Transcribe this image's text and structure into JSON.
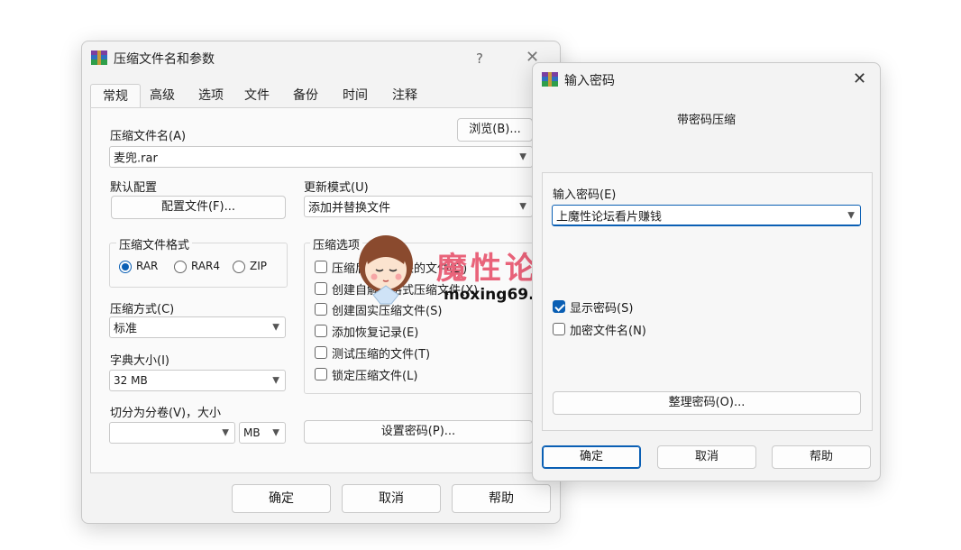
{
  "main_dialog": {
    "title": "压缩文件名和参数",
    "help_glyph": "?",
    "close_glyph": "✕",
    "tabs": [
      "常规",
      "高级",
      "选项",
      "文件",
      "备份",
      "时间",
      "注释"
    ],
    "archive_name_label": "压缩文件名(A)",
    "browse_button": "浏览(B)...",
    "archive_name_value": "麦兜.rar",
    "default_profile_label": "默认配置",
    "profile_button": "配置文件(F)...",
    "update_mode_label": "更新模式(U)",
    "update_mode_value": "添加并替换文件",
    "format_group_label": "压缩文件格式",
    "formats": [
      {
        "label": "RAR",
        "selected": true
      },
      {
        "label": "RAR4",
        "selected": false
      },
      {
        "label": "ZIP",
        "selected": false
      }
    ],
    "options_group_label": "压缩选项",
    "options": [
      {
        "label": "压缩后删除原来的文件(D)",
        "checked": false
      },
      {
        "label": "创建自解压格式压缩文件(X)",
        "checked": false
      },
      {
        "label": "创建固实压缩文件(S)",
        "checked": false
      },
      {
        "label": "添加恢复记录(E)",
        "checked": false
      },
      {
        "label": "测试压缩的文件(T)",
        "checked": false
      },
      {
        "label": "锁定压缩文件(L)",
        "checked": false
      }
    ],
    "method_label": "压缩方式(C)",
    "method_value": "标准",
    "dict_label": "字典大小(I)",
    "dict_value": "32 MB",
    "split_label": "切分为分卷(V)，大小",
    "split_value": "",
    "split_unit": "MB",
    "set_password_button": "设置密码(P)...",
    "ok_button": "确定",
    "cancel_button": "取消",
    "help_button": "帮助"
  },
  "password_dialog": {
    "title": "输入密码",
    "close_glyph": "✕",
    "heading": "带密码压缩",
    "password_label": "输入密码(E)",
    "password_value": "上魔性论坛看片赚钱",
    "show_password_label": "显示密码(S)",
    "show_password_checked": true,
    "encrypt_names_label": "加密文件名(N)",
    "encrypt_names_checked": false,
    "organize_button": "整理密码(O)...",
    "ok_button": "确定",
    "cancel_button": "取消",
    "help_button": "帮助"
  },
  "watermark": {
    "brand": "魔性论坛",
    "url": "moxing69.com"
  },
  "colors": {
    "accent": "#0a5fb4",
    "watermark": "#e9637a"
  }
}
